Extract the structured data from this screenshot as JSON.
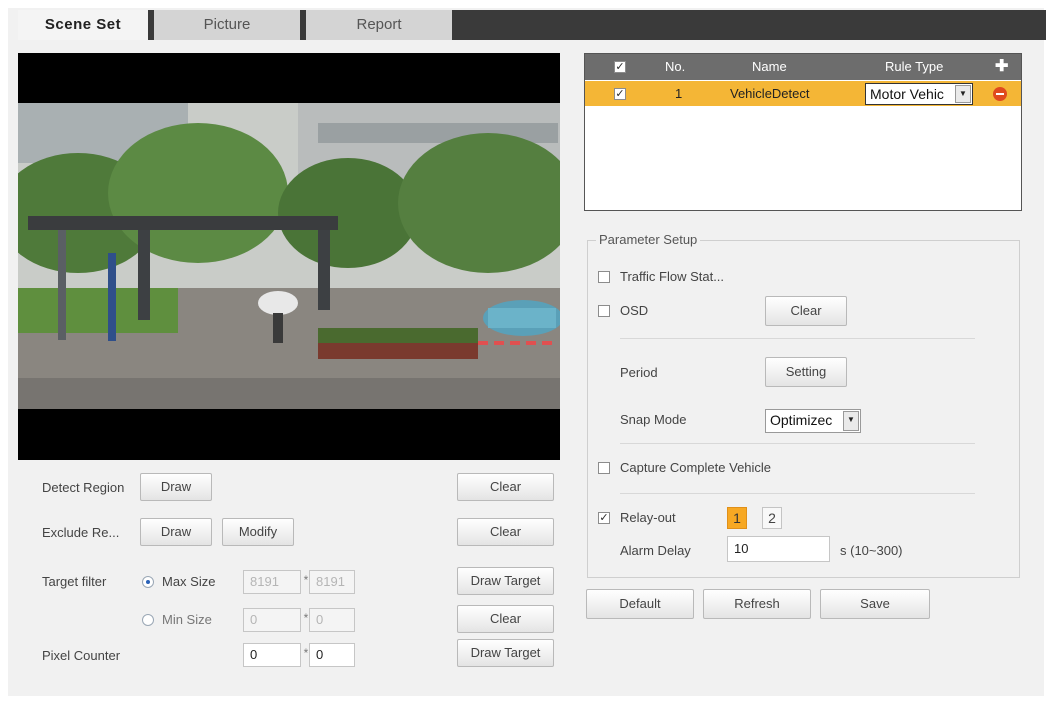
{
  "tabs": [
    {
      "label": "Scene Set",
      "active": true
    },
    {
      "label": "Picture",
      "active": false
    },
    {
      "label": "Report",
      "active": false
    }
  ],
  "left": {
    "detect_region": {
      "label": "Detect Region",
      "draw": "Draw",
      "clear": "Clear"
    },
    "exclude_region": {
      "label": "Exclude Re...",
      "draw": "Draw",
      "modify": "Modify",
      "clear": "Clear"
    },
    "target_filter": {
      "label": "Target filter",
      "max_size": {
        "label": "Max Size",
        "w": "8191",
        "h": "8191",
        "selected": true
      },
      "min_size": {
        "label": "Min Size",
        "w": "0",
        "h": "0",
        "selected": false
      },
      "draw_target": "Draw Target",
      "clear": "Clear"
    },
    "pixel_counter": {
      "label": "Pixel Counter",
      "w": "0",
      "h": "0",
      "draw_target": "Draw Target"
    },
    "times": "*"
  },
  "rules_table": {
    "headers": {
      "no": "No.",
      "name": "Name",
      "rule_type": "Rule Type"
    },
    "add_icon": "plus-icon",
    "rows": [
      {
        "checked": true,
        "no": "1",
        "name": "VehicleDetect",
        "rule_type": "Motor Vehic",
        "remove_icon": "minus-circle-icon"
      }
    ]
  },
  "params": {
    "legend": "Parameter Setup",
    "traffic_flow": {
      "label": "Traffic Flow Stat...",
      "checked": false
    },
    "osd": {
      "label": "OSD",
      "checked": false,
      "clear": "Clear"
    },
    "period": {
      "label": "Period",
      "button": "Setting"
    },
    "snap_mode": {
      "label": "Snap Mode",
      "value": "Optimizec"
    },
    "capture_complete": {
      "label": "Capture Complete Vehicle",
      "checked": false
    },
    "relay_out": {
      "label": "Relay-out",
      "checked": true,
      "options": [
        "1",
        "2"
      ],
      "selected": "1"
    },
    "alarm_delay": {
      "label": "Alarm Delay",
      "value": "10",
      "hint": "s (10~300)"
    }
  },
  "actions": {
    "default": "Default",
    "refresh": "Refresh",
    "save": "Save"
  },
  "colors": {
    "accent": "#f7a823",
    "header": "#6d6d6d",
    "tabbar": "#3a3a3a"
  }
}
